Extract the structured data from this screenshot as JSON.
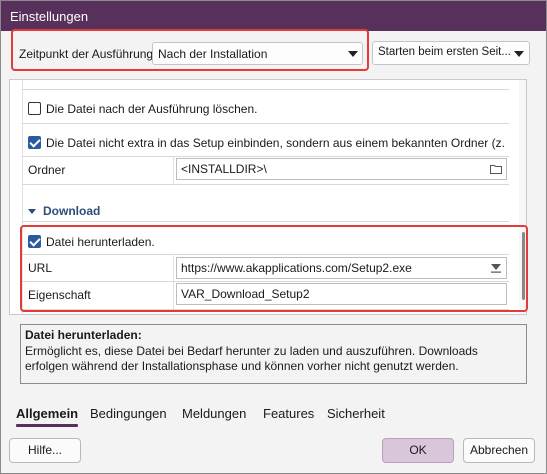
{
  "window": {
    "title": "Einstellungen"
  },
  "top": {
    "timing_label": "Zeitpunkt der Ausführung:",
    "timing_value": "Nach der Installation",
    "start_value": "Starten beim ersten Seit..."
  },
  "panel": {
    "delete_after_label": "Die Datei nach der Ausführung löschen.",
    "delete_after_checked": false,
    "not_embed_label": "Die Datei nicht extra in das Setup einbinden, sondern aus einem bekannten Ordner (z. ...",
    "not_embed_checked": true,
    "folder_label": "Ordner",
    "folder_value": "<INSTALLDIR>\\",
    "section_download": "Download",
    "download_label": "Datei herunterladen.",
    "download_checked": true,
    "url_label": "URL",
    "url_value": "https://www.akapplications.com/Setup2.exe",
    "property_label": "Eigenschaft",
    "property_value": "VAR_Download_Setup2"
  },
  "description": {
    "heading": "Datei herunterladen:",
    "text": "Ermöglicht es, diese Datei bei Bedarf herunter zu laden und auszuführen. Downloads erfolgen während der Installationsphase und können vorher nicht genutzt werden."
  },
  "tabs": [
    "Allgemein",
    "Bedingungen",
    "Meldungen",
    "Features",
    "Sicherheit"
  ],
  "active_tab": "Allgemein",
  "buttons": {
    "help": "Hilfe...",
    "ok": "OK",
    "cancel": "Abbrechen"
  },
  "colors": {
    "titlebar": "#57315c",
    "accent": "#2c5aa0",
    "highlight": "#e33a3a",
    "ok_button": "#d9c6da"
  }
}
